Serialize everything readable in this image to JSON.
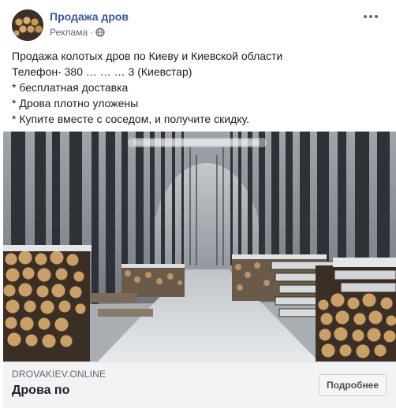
{
  "header": {
    "page_name": "Продажа дров",
    "sponsored": "Реклама",
    "separator": "·",
    "avatar_icon": "firewood-logs-avatar",
    "privacy_icon": "globe-icon",
    "menu_icon": "more-options-icon"
  },
  "post": {
    "lines": [
      "Продажа колотых дров по Киеву и Киевской области",
      "Телефон- 380 … … … 3 (Киевстар)",
      "* бесплатная доставка",
      "* Дрова плотно уложены",
      "* Купите вместе с соседом, и получите скидку."
    ]
  },
  "image": {
    "subject": "Snowy forest road lined with stacked logs",
    "watermark": "blurred text"
  },
  "link_preview": {
    "domain": "DROVAKIEV.ONLINE",
    "title": "Дрова по",
    "cta_label": "Подробнее"
  },
  "colors": {
    "link_blue": "#385898",
    "text": "#1c1e21",
    "muted": "#606770",
    "preview_bg": "#f2f3f5"
  }
}
